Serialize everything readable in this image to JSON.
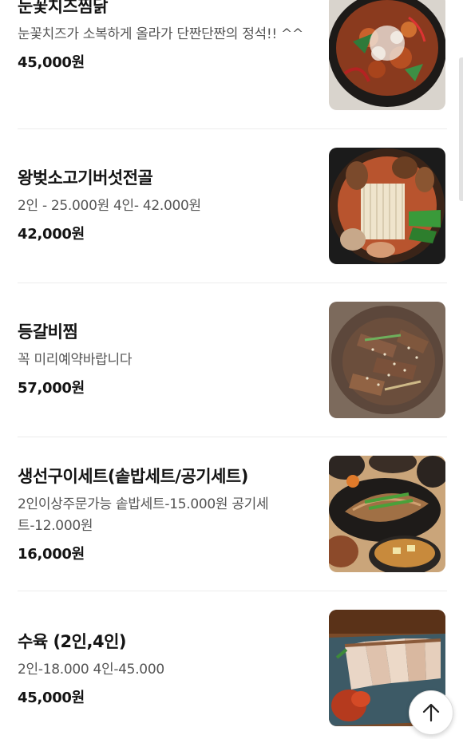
{
  "menu": {
    "items": [
      {
        "name": "눈꽃치즈찜닭",
        "description": "눈꽃치즈가 소복하게 올라가 단짠단짠의 정석!! ^^",
        "price": "45,000원",
        "image_icon": "cheese-jjimdak-photo"
      },
      {
        "name": "왕벚소고기버섯전골",
        "description": "2인 - 25.000원 4인- 42.000원",
        "price": "42,000원",
        "image_icon": "beef-mushroom-hotpot-photo"
      },
      {
        "name": "등갈비찜",
        "description": "꼭 미리예약바랍니다",
        "price": "57,000원",
        "image_icon": "braised-ribs-photo"
      },
      {
        "name": "생선구이세트(솥밥세트/공기세트)",
        "description": "2인이상주문가능 솥밥세트-15.000원 공기세트-12.000원",
        "price": "16,000원",
        "image_icon": "grilled-fish-set-photo"
      },
      {
        "name": "수육 (2인,4인)",
        "description": "2인-18.000 4인-45.000",
        "price": "45,000원",
        "image_icon": "boiled-pork-photo"
      }
    ]
  },
  "scroll_top_button": {
    "icon": "arrow-up-icon"
  }
}
